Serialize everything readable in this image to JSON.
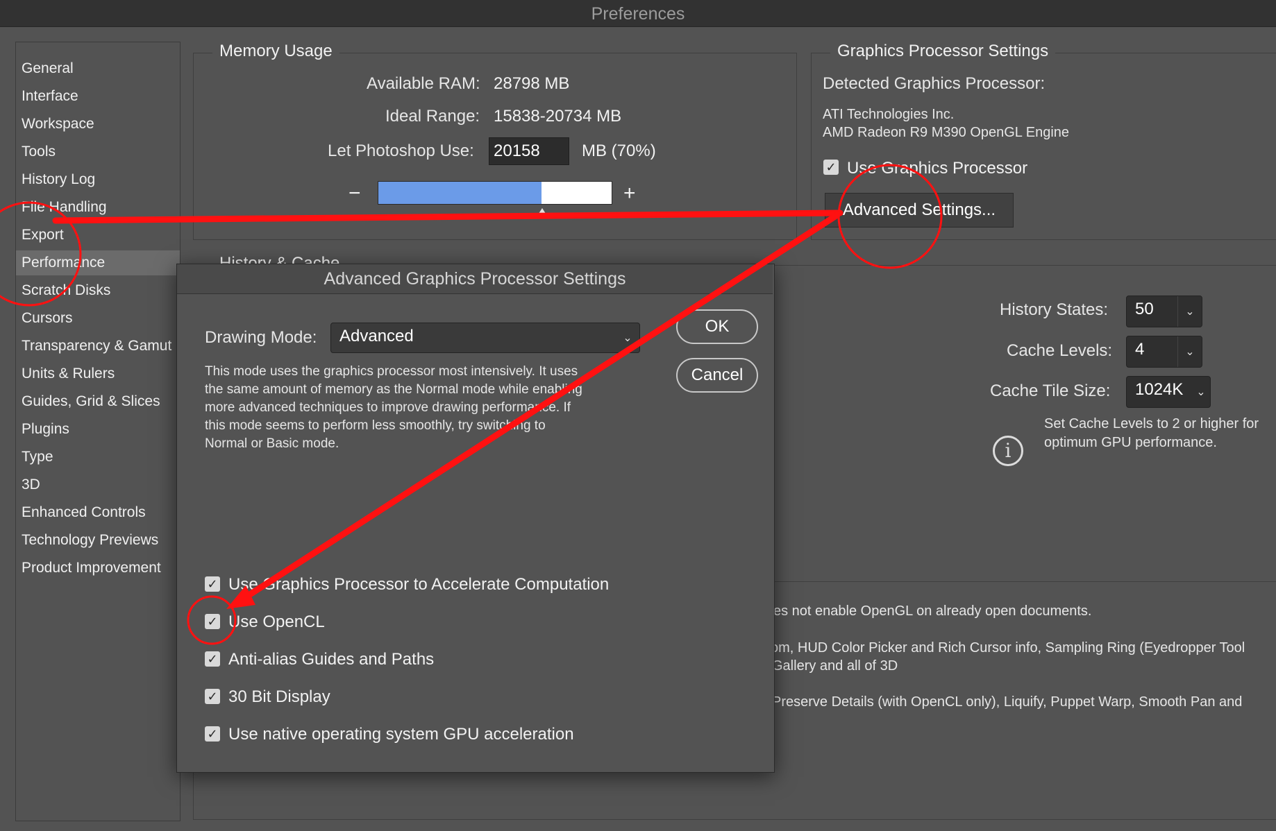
{
  "window": {
    "title": "Preferences"
  },
  "sidebar": {
    "items": [
      {
        "label": "General"
      },
      {
        "label": "Interface"
      },
      {
        "label": "Workspace"
      },
      {
        "label": "Tools"
      },
      {
        "label": "History Log"
      },
      {
        "label": "File Handling"
      },
      {
        "label": "Export"
      },
      {
        "label": "Performance"
      },
      {
        "label": "Scratch Disks"
      },
      {
        "label": "Cursors"
      },
      {
        "label": "Transparency & Gamut"
      },
      {
        "label": "Units & Rulers"
      },
      {
        "label": "Guides, Grid & Slices"
      },
      {
        "label": "Plugins"
      },
      {
        "label": "Type"
      },
      {
        "label": "3D"
      },
      {
        "label": "Enhanced Controls"
      },
      {
        "label": "Technology Previews"
      },
      {
        "label": "Product Improvement"
      }
    ],
    "active": "Performance"
  },
  "memory": {
    "title": "Memory Usage",
    "available_label": "Available RAM:",
    "available_value": "28798 MB",
    "ideal_label": "Ideal Range:",
    "ideal_value": "15838-20734 MB",
    "use_label": "Let Photoshop Use:",
    "use_value": "20158",
    "use_unit": "MB (70%)",
    "minus": "−",
    "plus": "+",
    "slider_fraction": 0.7
  },
  "gpu": {
    "title": "Graphics Processor Settings",
    "detected_label": "Detected Graphics Processor:",
    "vendor": "ATI Technologies Inc.",
    "model": "AMD Radeon R9 M390 OpenGL Engine",
    "use_gpu_label": "Use Graphics Processor",
    "use_gpu_checked": true,
    "advanced_button": "Advanced Settings..."
  },
  "history_cache": {
    "title": "History & Cache",
    "history_states_label": "History States:",
    "history_states_value": "50",
    "cache_levels_label": "Cache Levels:",
    "cache_levels_value": "4",
    "tile_size_label": "Cache Tile Size:",
    "tile_size_value": "1024K",
    "info_line1": "Set Cache Levels to 2 or higher for",
    "info_line2": "optimum GPU performance."
  },
  "description_area": {
    "line1": "es not enable OpenGL on already open documents.",
    "line2": "om, HUD Color Picker and Rich Cursor info, Sampling Ring (Eyedropper Tool",
    "line3": " Gallery and all of 3D",
    "line4": "Preserve Details (with OpenCL only), Liquify, Puppet Warp, Smooth Pan and"
  },
  "dialog": {
    "title": "Advanced Graphics Processor Settings",
    "drawing_mode_label": "Drawing Mode:",
    "drawing_mode_value": "Advanced",
    "ok": "OK",
    "cancel": "Cancel",
    "description": [
      "This mode uses the graphics processor most intensively.  It uses",
      "the same amount of memory as the Normal mode while enabling",
      "more advanced techniques to improve drawing performance.  If",
      "this mode seems to perform less smoothly, try switching to",
      "Normal or Basic mode."
    ],
    "options": [
      {
        "label": "Use Graphics Processor to Accelerate Computation",
        "checked": true
      },
      {
        "label": "Use OpenCL",
        "checked": true
      },
      {
        "label": "Anti-alias Guides and Paths",
        "checked": true
      },
      {
        "label": "30 Bit Display",
        "checked": true
      },
      {
        "label": "Use native operating system GPU acceleration",
        "checked": true
      }
    ]
  },
  "annotation": {
    "color": "#ff1111"
  },
  "icons": {
    "checkmark": "checkmark-icon",
    "info": "info-icon",
    "chevron": "chevron-down-icon"
  }
}
